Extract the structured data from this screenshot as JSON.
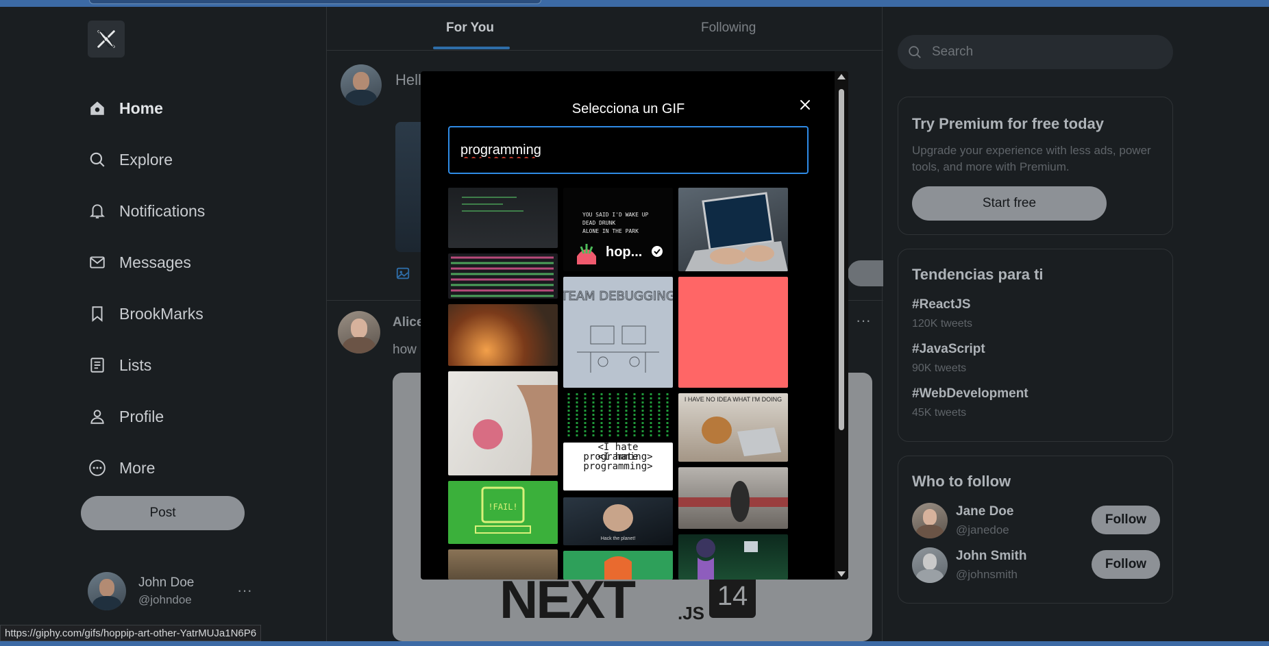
{
  "sidebar": {
    "items": [
      {
        "label": "Home",
        "icon": "home-icon"
      },
      {
        "label": "Explore",
        "icon": "search-icon"
      },
      {
        "label": "Notifications",
        "icon": "bell-icon"
      },
      {
        "label": "Messages",
        "icon": "mail-icon"
      },
      {
        "label": "BrookMarks",
        "icon": "bookmark-icon"
      },
      {
        "label": "Lists",
        "icon": "list-icon"
      },
      {
        "label": "Profile",
        "icon": "person-icon"
      },
      {
        "label": "More",
        "icon": "more-circle-icon"
      }
    ],
    "post_label": "Post",
    "user": {
      "name": "John Doe",
      "handle": "@johndoe",
      "more": "···"
    }
  },
  "feed": {
    "tabs": [
      {
        "label": "For You"
      },
      {
        "label": "Following"
      }
    ],
    "compose_text": "Hell",
    "tweet": {
      "name": "Alice",
      "text": "how",
      "more": "···"
    },
    "media": {
      "logo": "NEXT",
      "suffix": ".JS",
      "version": "14"
    }
  },
  "right": {
    "search_placeholder": "Search",
    "premium": {
      "title": "Try Premium for free today",
      "desc": "Upgrade your experience with less ads, power tools, and more with Premium.",
      "button": "Start free"
    },
    "trends": {
      "title": "Tendencias para ti",
      "items": [
        {
          "tag": "#ReactJS",
          "count": "120K tweets"
        },
        {
          "tag": "#JavaScript",
          "count": "90K tweets"
        },
        {
          "tag": "#WebDevelopment",
          "count": "45K tweets"
        }
      ]
    },
    "follow": {
      "title": "Who to follow",
      "items": [
        {
          "name": "Jane Doe",
          "handle": "@janedoe",
          "button": "Follow"
        },
        {
          "name": "John Smith",
          "handle": "@johnsmith",
          "button": "Follow"
        }
      ]
    }
  },
  "modal": {
    "title": "Selecciona un GIF",
    "search_value": "programming",
    "gifs": {
      "dead_drunk_caption": "YOU SAID I'D WAKE UP\nDEAD DRUNK\nALONE IN THE PARK",
      "hoppip_label": "hop...",
      "team_label": "TEAM DEBUGGING",
      "idea_caption": "I HAVE NO IDEA WHAT I'M DOING",
      "hate_caption": "<I hate programming>",
      "fail_caption": "!FAIL!",
      "hack_caption": "Hack the planet!"
    }
  },
  "status_url": "https://giphy.com/gifs/hoppip-art-other-YatrMUJa1N6P6",
  "colors": {
    "accent": "#2f8be6",
    "gif_pink": "#ff6666",
    "matrix_green": "#1f9a3a"
  }
}
